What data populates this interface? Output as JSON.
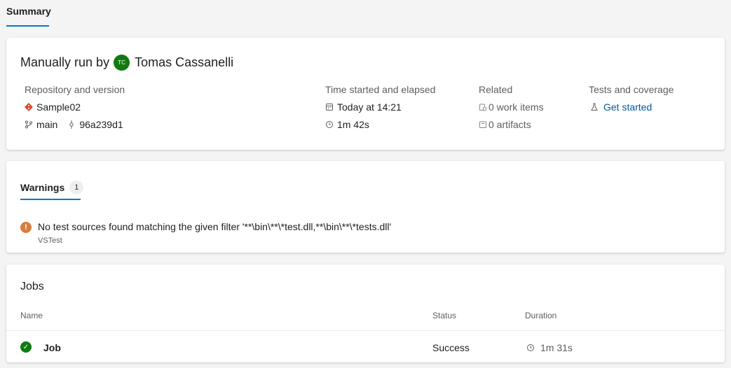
{
  "tabs": {
    "summary_label": "Summary"
  },
  "run": {
    "title_prefix": "Manually run by",
    "avatar_initials": "TC",
    "user_name": "Tomas Cassanelli",
    "repo_label": "Repository and version",
    "repo_name": "Sample02",
    "branch": "main",
    "commit": "96a239d1",
    "time_label": "Time started and elapsed",
    "started": "Today at 14:21",
    "elapsed": "1m 42s",
    "related_label": "Related",
    "work_items": "0 work items",
    "artifacts": "0 artifacts",
    "tests_label": "Tests and coverage",
    "get_started": "Get started"
  },
  "warnings": {
    "tab_label": "Warnings",
    "count": "1",
    "message": "No test sources found matching the given filter '**\\bin\\**\\*test.dll,**\\bin\\**\\*tests.dll'",
    "source": "VSTest"
  },
  "jobs": {
    "title": "Jobs",
    "columns": {
      "name": "Name",
      "status": "Status",
      "duration": "Duration"
    },
    "rows": [
      {
        "name": "Job",
        "status": "Success",
        "duration": "1m 31s"
      }
    ]
  },
  "colors": {
    "accent": "#0078d4",
    "success": "#107c10",
    "warning": "#d67f3c"
  }
}
